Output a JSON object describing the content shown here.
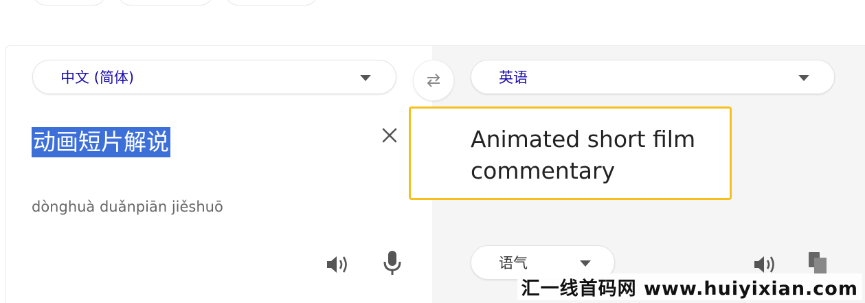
{
  "source": {
    "language": "中文 (简体)",
    "text": "动画短片解说",
    "pinyin": "dònghuà duǎnpiān jiěshuō"
  },
  "target": {
    "language": "英语",
    "translation": "Animated short film commentary",
    "tone_label": "语气"
  },
  "icons": {
    "swap": "swap-arrows-icon",
    "clear": "close-icon",
    "speaker": "speaker-icon",
    "microphone": "microphone-icon",
    "copy": "copy-icon"
  },
  "colors": {
    "highlight": "#3d6fd8",
    "translation_border": "#f5c01e",
    "language_text": "#1a0dab",
    "right_pane_bg": "#f5f5f5"
  },
  "watermark": "汇一线首码网 www.huiyixian.com"
}
